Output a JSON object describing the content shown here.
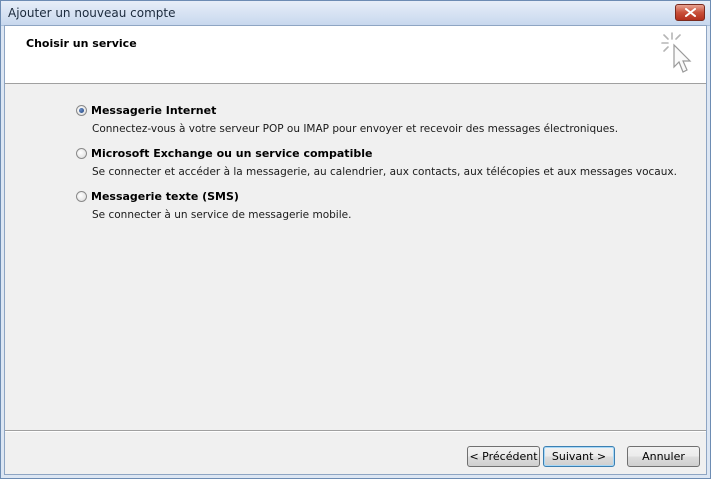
{
  "window": {
    "title": "Ajouter un nouveau compte"
  },
  "header": {
    "title": "Choisir un service"
  },
  "options": [
    {
      "label": "Messagerie Internet",
      "description": "Connectez-vous à votre serveur POP ou IMAP pour envoyer et recevoir des messages électroniques.",
      "checked": true
    },
    {
      "label": "Microsoft Exchange ou un service compatible",
      "description": "Se connecter et accéder à la messagerie, au calendrier, aux contacts, aux télécopies et aux messages vocaux.",
      "checked": false
    },
    {
      "label": "Messagerie texte (SMS)",
      "description": "Se connecter à un service de messagerie mobile.",
      "checked": false
    }
  ],
  "buttons": {
    "back": "< Précédent",
    "next": "Suivant >",
    "cancel": "Annuler"
  },
  "colors": {
    "accent": "#3c7fb1",
    "close": "#c9503a",
    "titlebar": "#c8d8ee"
  },
  "icons": {
    "header": "sparkle-cursor-icon",
    "close": "close-icon"
  }
}
